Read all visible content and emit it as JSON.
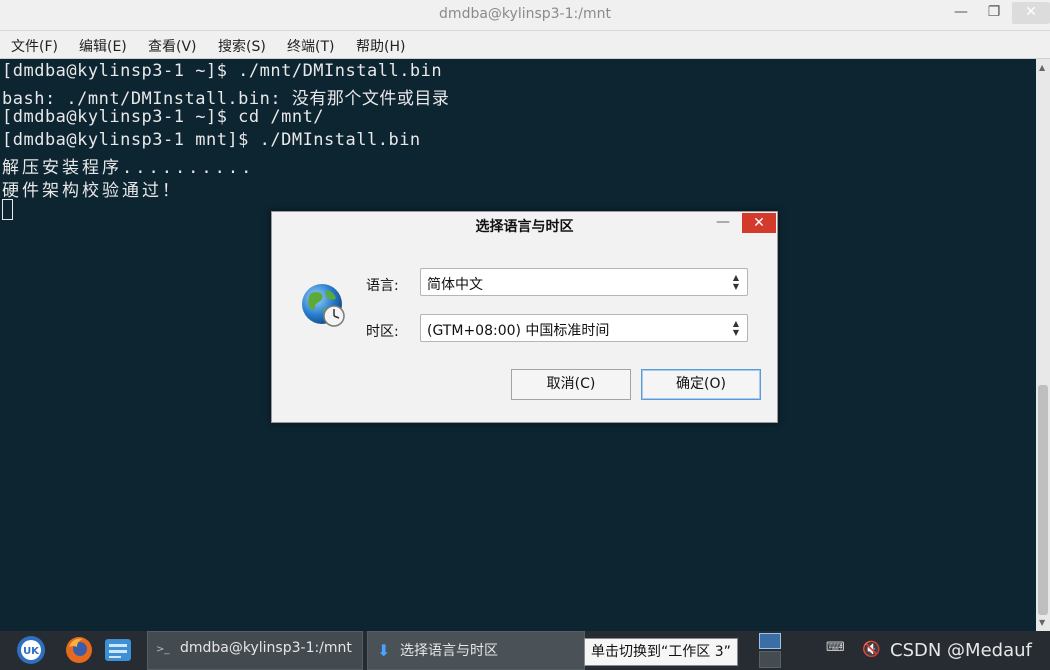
{
  "window": {
    "title": "dmdba@kylinsp3-1:/mnt",
    "min_glyph": "—",
    "max_glyph": "❐",
    "close_glyph": "✕"
  },
  "menu": [
    "文件(F)",
    "编辑(E)",
    "查看(V)",
    "搜索(S)",
    "终端(T)",
    "帮助(H)"
  ],
  "terminal": {
    "lines": [
      "[dmdba@kylinsp3-1 ~]$ ./mnt/DMInstall.bin",
      "bash: ./mnt/DMInstall.bin: 没有那个文件或目录",
      "[dmdba@kylinsp3-1 ~]$ cd /mnt/",
      "[dmdba@kylinsp3-1 mnt]$ ./DMInstall.bin",
      "解压安装程序..........",
      "硬件架构校验通过！"
    ],
    "colors": {
      "background": "#0d2431",
      "foreground": "#e8e8e8"
    }
  },
  "dialog": {
    "title": "选择语言与时区",
    "icon": "globe-clock-icon",
    "language_label": "语言:",
    "language_value": "简体中文",
    "timezone_label": "时区:",
    "timezone_value": "(GTM+08:00) 中国标准时间",
    "cancel_label": "取消(C)",
    "ok_label": "确定(O)",
    "close_color": "#d33a2c"
  },
  "taskbar": {
    "tasks": [
      {
        "label": "dmdba@kylinsp3-1:/mnt",
        "icon": "terminal-icon"
      },
      {
        "label": "选择语言与时区",
        "icon": "download-arrow-icon"
      }
    ],
    "tooltip": "单击切换到“工作区 3”",
    "watermark": "CSDN @Medauf",
    "start_icon": "kylin-uk-icon",
    "apps": [
      "firefox-icon",
      "file-manager-icon"
    ]
  }
}
